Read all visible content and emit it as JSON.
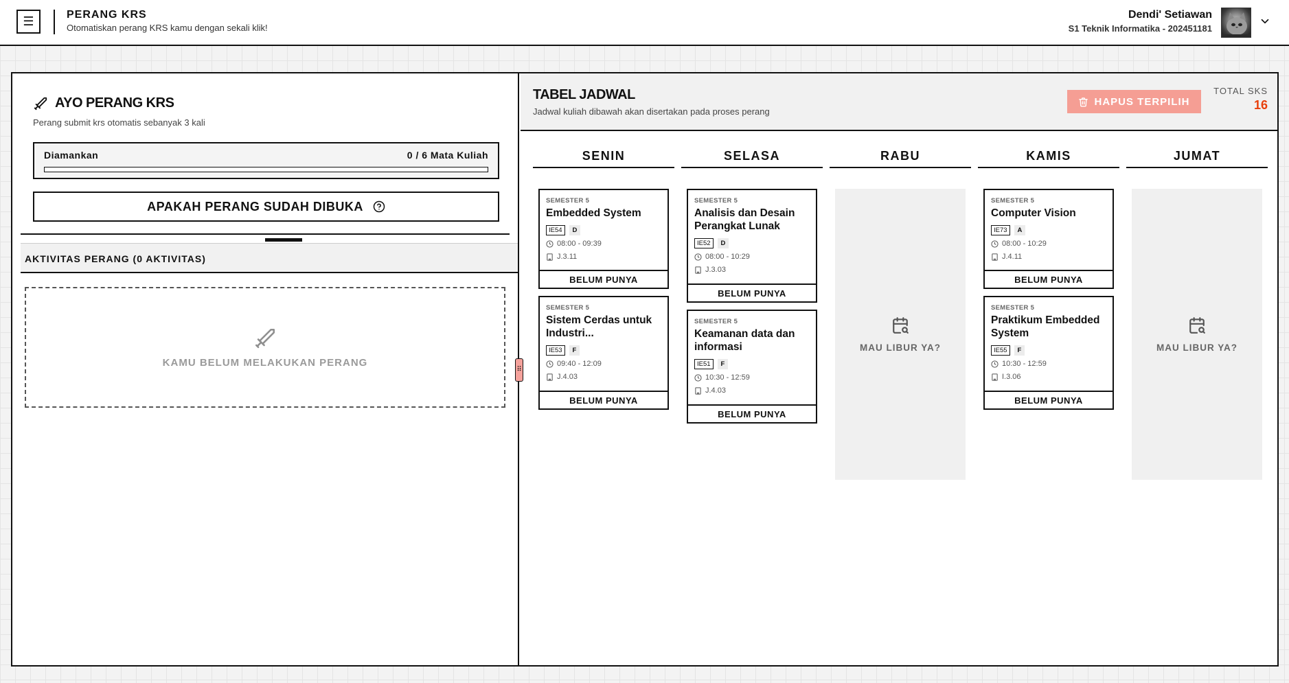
{
  "header": {
    "app_title": "PERANG KRS",
    "app_subtitle": "Otomatiskan perang KRS kamu dengan sekali klik!",
    "user_name": "Dendi' Setiawan",
    "user_prodi": "S1 Teknik Informatika - 202451181"
  },
  "perang": {
    "title": "AYO PERANG KRS",
    "subtitle": "Perang submit krs otomatis sebanyak 3 kali",
    "secured_label": "Diamankan",
    "secured_count": "0 / 6 Mata Kuliah",
    "secured_fraction": 0,
    "check_button": "APAKAH PERANG SUDAH DIBUKA"
  },
  "aktivitas": {
    "title": "AKTIVITAS PERANG (0 AKTIVITAS)",
    "empty_text": "KAMU BELUM MELAKUKAN PERANG"
  },
  "jadwal": {
    "title": "TABEL JADWAL",
    "subtitle": "Jadwal kuliah dibawah akan disertakan pada proses perang",
    "delete_button": "HAPUS TERPILIH",
    "total_label": "TOTAL SKS",
    "total_value": "16",
    "empty_day_text": "MAU LIBUR YA?",
    "days": [
      {
        "name": "SENIN",
        "courses": [
          {
            "semester": "SEMESTER 5",
            "name": "Embedded System",
            "code": "IE54",
            "class": "D",
            "time": "08:00 - 09:39",
            "room": "J.3.11",
            "status": "BELUM PUNYA"
          },
          {
            "semester": "SEMESTER 5",
            "name": "Sistem Cerdas untuk Industri...",
            "code": "IE53",
            "class": "F",
            "time": "09:40 - 12:09",
            "room": "J.4.03",
            "status": "BELUM PUNYA"
          }
        ]
      },
      {
        "name": "SELASA",
        "courses": [
          {
            "semester": "SEMESTER 5",
            "name": "Analisis dan Desain Perangkat Lunak",
            "code": "IE52",
            "class": "D",
            "time": "08:00 - 10:29",
            "room": "J.3.03",
            "status": "BELUM PUNYA"
          },
          {
            "semester": "SEMESTER 5",
            "name": "Keamanan data dan informasi",
            "code": "IE51",
            "class": "F",
            "time": "10:30 - 12:59",
            "room": "J.4.03",
            "status": "BELUM PUNYA"
          }
        ]
      },
      {
        "name": "RABU",
        "courses": []
      },
      {
        "name": "KAMIS",
        "courses": [
          {
            "semester": "SEMESTER 5",
            "name": "Computer Vision",
            "code": "IE73",
            "class": "A",
            "time": "08:00 - 10:29",
            "room": "J.4.11",
            "status": "BELUM PUNYA"
          },
          {
            "semester": "SEMESTER 5",
            "name": "Praktikum Embedded System",
            "code": "IE55",
            "class": "F",
            "time": "10:30 - 12:59",
            "room": "I.3.06",
            "status": "BELUM PUNYA"
          }
        ]
      },
      {
        "name": "JUMAT",
        "courses": []
      }
    ]
  },
  "colors": {
    "accent_red": "#e8400c",
    "delete_button": "#f59e94",
    "resize_handle": "#f5a29c"
  },
  "icons": {
    "menu": "menu-icon",
    "chevron": "chevron-down-icon",
    "sword": "sword-icon",
    "help": "help-circle-icon",
    "trash": "trash-icon",
    "clock": "clock-icon",
    "building": "building-icon",
    "calendar": "calendar-search-icon",
    "grip": "grip-icon"
  }
}
